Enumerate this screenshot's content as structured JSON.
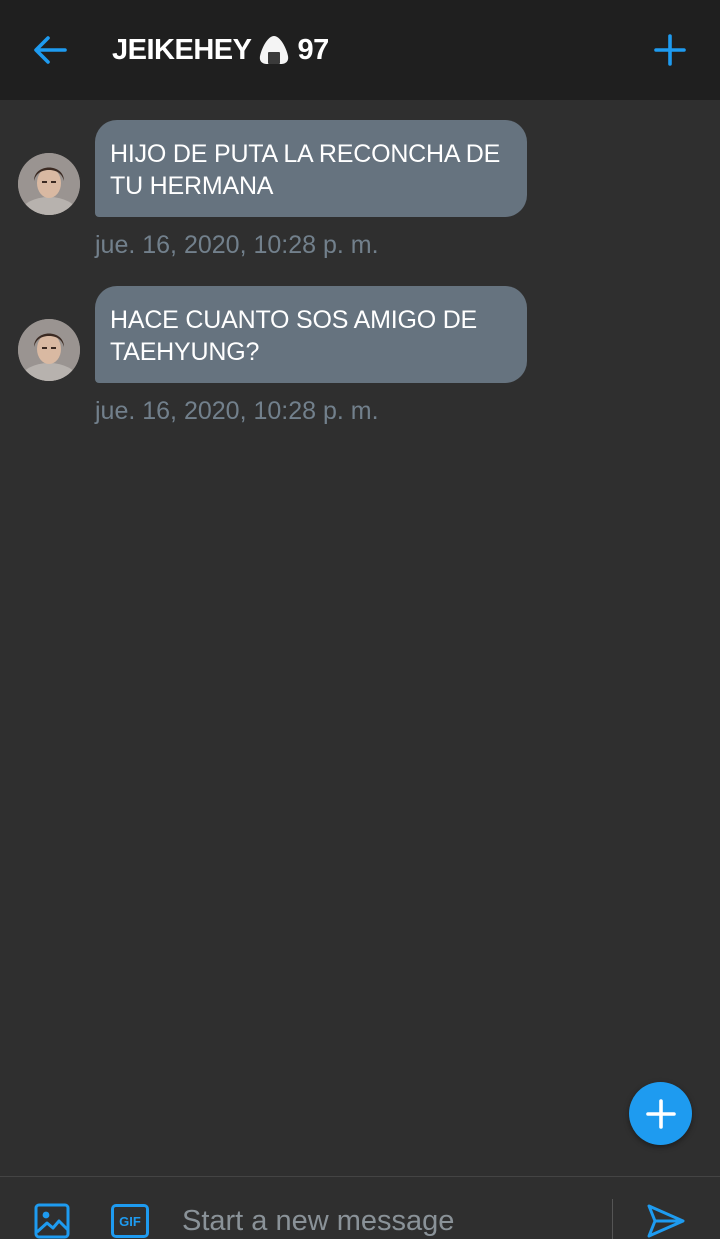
{
  "header": {
    "title": "JEIKEHEY",
    "title_suffix": "97",
    "back_icon": "arrow-left-icon",
    "add_icon": "plus-icon"
  },
  "messages": [
    {
      "text": "HIJO DE PUTA LA RECONCHA DE TU HERMANA",
      "timestamp": "jue. 16, 2020, 10:28 p. m."
    },
    {
      "text": "HACE CUANTO SOS AMIGO DE TAEHYUNG?",
      "timestamp": "jue. 16, 2020, 10:28 p. m."
    }
  ],
  "composer": {
    "placeholder": "Start a new message",
    "value": "",
    "image_icon": "image-icon",
    "gif_label": "GIF",
    "send_icon": "send-icon"
  },
  "fab_icon": "plus-icon",
  "colors": {
    "accent": "#1e9bf0",
    "background": "#2f2f2f",
    "header_background": "#1f1f1f",
    "bubble": "#66737f",
    "timestamp": "#72808c"
  }
}
